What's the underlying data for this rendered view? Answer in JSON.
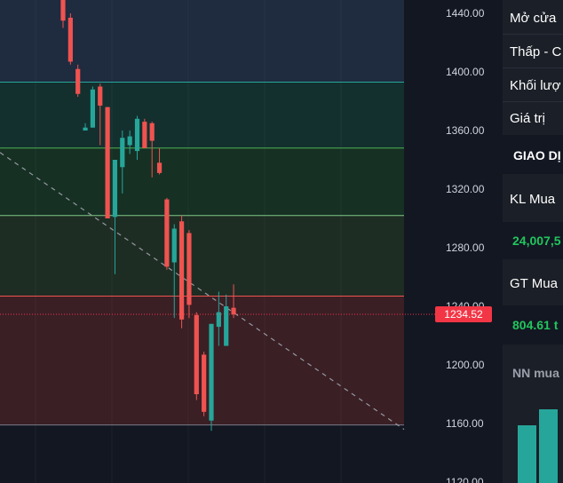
{
  "chart_data": {
    "type": "candlestick",
    "y_ticks": [
      "1440.00",
      "1400.00",
      "1360.00",
      "1320.00",
      "1280.00",
      "1240.00",
      "1200.00",
      "1160.00",
      "1120.00"
    ],
    "ylim": [
      1115,
      1450
    ],
    "current_price": 1234.52,
    "current_price_label": "1234.52",
    "fib_levels": [
      1393,
      1348,
      1302,
      1247,
      1159
    ],
    "trendline": {
      "from": [
        0,
        1345
      ],
      "to": [
        46,
        1156
      ]
    },
    "candles": [
      {
        "o": 1450,
        "h": 1460,
        "l": 1430,
        "c": 1435
      },
      {
        "o": 1437,
        "h": 1440,
        "l": 1405,
        "c": 1407
      },
      {
        "o": 1402,
        "h": 1405,
        "l": 1383,
        "c": 1385
      },
      {
        "o": 1360,
        "h": 1365,
        "l": 1360,
        "c": 1362
      },
      {
        "o": 1362,
        "h": 1390,
        "l": 1362,
        "c": 1388
      },
      {
        "o": 1390,
        "h": 1392,
        "l": 1350,
        "c": 1377
      },
      {
        "o": 1376,
        "h": 1376,
        "l": 1325,
        "c": 1300
      },
      {
        "o": 1301,
        "h": 1340,
        "l": 1262,
        "c": 1340
      },
      {
        "o": 1335,
        "h": 1360,
        "l": 1317,
        "c": 1355
      },
      {
        "o": 1350,
        "h": 1360,
        "l": 1344,
        "c": 1356
      },
      {
        "o": 1346,
        "h": 1370,
        "l": 1340,
        "c": 1368
      },
      {
        "o": 1366,
        "h": 1368,
        "l": 1348,
        "c": 1348
      },
      {
        "o": 1365,
        "h": 1366,
        "l": 1328,
        "c": 1353
      },
      {
        "o": 1338,
        "h": 1348,
        "l": 1330,
        "c": 1331
      },
      {
        "o": 1313,
        "h": 1314,
        "l": 1265,
        "c": 1267
      },
      {
        "o": 1270,
        "h": 1296,
        "l": 1232,
        "c": 1293
      },
      {
        "o": 1298,
        "h": 1302,
        "l": 1225,
        "c": 1231
      },
      {
        "o": 1290,
        "h": 1292,
        "l": 1232,
        "c": 1241
      },
      {
        "o": 1234,
        "h": 1236,
        "l": 1176,
        "c": 1180
      },
      {
        "o": 1207,
        "h": 1209,
        "l": 1165,
        "c": 1168
      },
      {
        "o": 1162,
        "h": 1228,
        "l": 1155,
        "c": 1228
      },
      {
        "o": 1226,
        "h": 1250,
        "l": 1213,
        "c": 1236
      },
      {
        "o": 1213,
        "h": 1248,
        "l": 1213,
        "c": 1240
      },
      {
        "o": 1239,
        "h": 1255,
        "l": 1232,
        "c": 1234.52
      }
    ]
  },
  "panel": {
    "open_label": "Mở cửa",
    "low_high_label": "Thấp - C",
    "volume_label": "Khối lượ",
    "value_label": "Giá trị",
    "section_title": "GIAO DỊ",
    "buy_volume_label": "KL Mua",
    "buy_volume_value": "24,007,5",
    "buy_value_label": "GT Mua",
    "buy_value_value": "804.61 t",
    "foreign_buy_label": "NN mua"
  },
  "colors": {
    "up": "#26a69a",
    "down": "#ef5350",
    "positive_text": "#22c55e",
    "price_tag": "#f23645"
  }
}
